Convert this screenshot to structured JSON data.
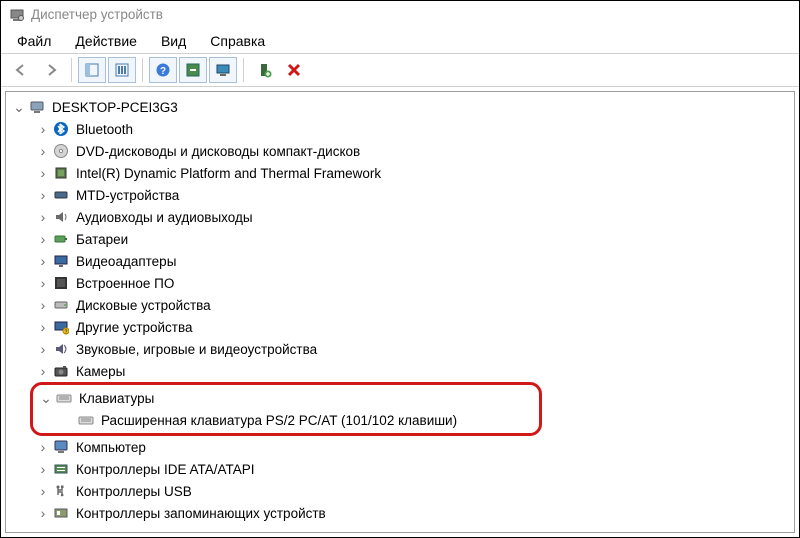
{
  "window": {
    "title": "Диспетчер устройств"
  },
  "menu": {
    "file": "Файл",
    "action": "Действие",
    "view": "Вид",
    "help": "Справка"
  },
  "toolbar": {
    "back": "back",
    "forward": "forward",
    "show_hide_console": "show-hide-console-tree",
    "properties": "properties",
    "help": "help",
    "scan": "scan-hardware",
    "monitor": "show-hidden",
    "add": "add-hardware",
    "remove": "remove"
  },
  "tree": {
    "root": "DESKTOP-PCEI3G3",
    "nodes": [
      {
        "icon": "bluetooth",
        "label": "Bluetooth"
      },
      {
        "icon": "dvd",
        "label": "DVD-дисководы и дисководы компакт-дисков"
      },
      {
        "icon": "chip",
        "label": "Intel(R) Dynamic Platform and Thermal Framework"
      },
      {
        "icon": "mtd",
        "label": "MTD-устройства"
      },
      {
        "icon": "audio",
        "label": "Аудиовходы и аудиовыходы"
      },
      {
        "icon": "battery",
        "label": "Батареи"
      },
      {
        "icon": "display",
        "label": "Видеоадаптеры"
      },
      {
        "icon": "firmware",
        "label": "Встроенное ПО"
      },
      {
        "icon": "disk",
        "label": "Дисковые устройства"
      },
      {
        "icon": "other",
        "label": "Другие устройства"
      },
      {
        "icon": "sound",
        "label": "Звуковые, игровые и видеоустройства"
      },
      {
        "icon": "camera",
        "label": "Камеры"
      }
    ],
    "keyboards": {
      "label": "Клавиатуры",
      "child": "Расширенная клавиатура PS/2 PC/AT (101/102 клавиши)"
    },
    "after": [
      {
        "icon": "computer",
        "label": "Компьютер"
      },
      {
        "icon": "ide",
        "label": "Контроллеры IDE ATA/ATAPI"
      },
      {
        "icon": "usb",
        "label": "Контроллеры USB"
      },
      {
        "icon": "storage-ctrl",
        "label": "Контроллеры запоминающих устройств"
      }
    ]
  }
}
